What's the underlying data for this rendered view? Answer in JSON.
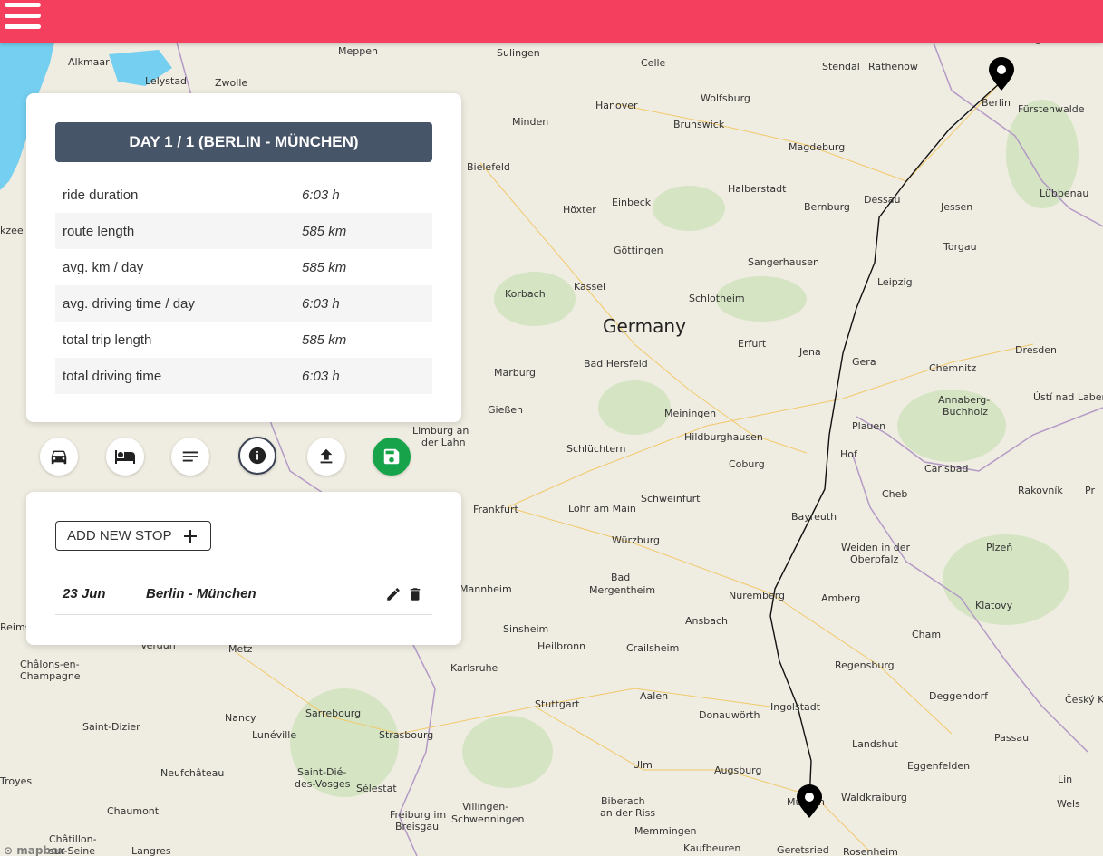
{
  "header": {
    "menu_icon": "hamburger-menu-icon",
    "color": "#f43f5e"
  },
  "stats_card": {
    "title": "DAY 1 / 1 (BERLIN - MÜNCHEN)",
    "rows": [
      {
        "label": "ride duration",
        "value": "6:03 h"
      },
      {
        "label": "route length",
        "value": "585 km"
      },
      {
        "label": "avg. km / day",
        "value": "585 km"
      },
      {
        "label": "avg. driving time / day",
        "value": "6:03 h"
      },
      {
        "label": "total trip length",
        "value": "585 km"
      },
      {
        "label": "total driving time",
        "value": "6:03 h"
      }
    ]
  },
  "toolbar": {
    "buttons": [
      {
        "icon": "car-icon"
      },
      {
        "icon": "bed-icon"
      },
      {
        "icon": "notes-icon"
      },
      {
        "icon": "info-icon",
        "active": true
      },
      {
        "icon": "upload-icon"
      },
      {
        "icon": "save-icon",
        "color": "#16a34a"
      }
    ]
  },
  "stops_card": {
    "add_button": "ADD NEW STOP",
    "stops": [
      {
        "date": "23 Jun",
        "name": "Berlin - München",
        "edit_icon": "pencil-icon",
        "delete_icon": "trash-icon"
      }
    ]
  },
  "map": {
    "country_label": "Germany",
    "attribution": "mapbox",
    "markers": [
      {
        "name": "Berlin"
      },
      {
        "name": "München"
      }
    ],
    "labels": [
      "Alkmaar",
      "Lelystad",
      "Zwolle",
      "Meppen",
      "Sulingen",
      "Celle",
      "Stendal",
      "Rathenow",
      "Oranienburg",
      "Wolfsburg",
      "Hanover",
      "Minden",
      "Brunswick",
      "Berlin",
      "Fürstenwalde",
      "Magdeburg",
      "Bielefeld",
      "Halberstadt",
      "Dessau",
      "Lübbenau",
      "Einbeck",
      "Höxter",
      "Bernburg",
      "Jessen",
      "Göttingen",
      "Torgau",
      "Sangerhausen",
      "Korbach",
      "Kassel",
      "Schlotheim",
      "Leipzig",
      "Erfurt",
      "Jena",
      "Dresden",
      "Marburg",
      "Bad Hersfeld",
      "Gera",
      "Chemnitz",
      "Annaberg-Buchholz",
      "Ústí nad Labem",
      "Gießen",
      "Meiningen",
      "Hildburghausen",
      "Plauen",
      "Limburg an der Lahn",
      "Schlüchtern",
      "Hof",
      "Coburg",
      "Carlsbad",
      "Frankfurt",
      "Schweinfurt",
      "Cheb",
      "Rakovník",
      "Lohr am Main",
      "Bayreuth",
      "Würzburg",
      "Weiden in der Oberpfalz",
      "Plzeň",
      "Bad Mergentheim",
      "Nuremberg",
      "Amberg",
      "Mannheim",
      "Klatovy",
      "Ansbach",
      "Sinsheim",
      "Heilbronn",
      "Crailsheim",
      "Cham",
      "Metz",
      "Regensburg",
      "Karlsruhe",
      "Châlons-en-Champagne",
      "Aalen",
      "Deggendorf",
      "Stuttgart",
      "Ingolstadt",
      "Český Krumlov",
      "Donauwörth",
      "Sarrebourg",
      "Saint-Dizier",
      "Nancy",
      "Strasbourg",
      "Passau",
      "Lunéville",
      "Landshut",
      "Ulm",
      "Eggenfelden",
      "Augsburg",
      "Neufchâteau",
      "Saint-Dié-des-Vosges",
      "Sélestat",
      "Waldkraiburg",
      "Troyes",
      "Biberach an der Riss",
      "Wels",
      "Chaumont",
      "Freiburg im Breisgau",
      "Villingen-Schwenningen",
      "Memmingen",
      "Kaufbeuren",
      "Geretsried",
      "Rosenheim",
      "Langres",
      "Châtillon-sur-Seine",
      "Reims",
      "Verdun"
    ]
  }
}
